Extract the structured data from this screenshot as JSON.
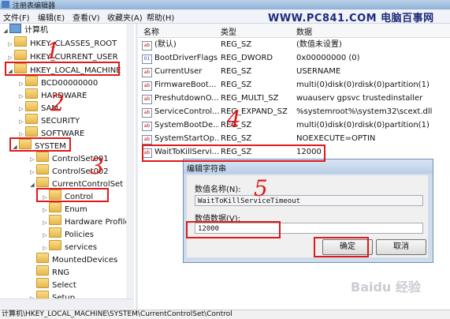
{
  "window": {
    "title": "注册表编辑器"
  },
  "menu": [
    "文件(F)",
    "编辑(E)",
    "查看(V)",
    "收藏夹(A)",
    "帮助(H)"
  ],
  "watermark": "WWW.PC841.COM 电脑百事网",
  "tree": {
    "root": "计算机",
    "items": [
      "HKEY_CLASSES_ROOT",
      "HKEY_CURRENT_USER",
      "HKEY_LOCAL_MACHINE",
      "BCD00000000",
      "HARDWARE",
      "SAM",
      "SECURITY",
      "SOFTWARE",
      "SYSTEM",
      "ControlSet001",
      "ControlSet002",
      "CurrentControlSet",
      "Control",
      "Enum",
      "Hardware Profile",
      "Policies",
      "services",
      "MountedDevices",
      "RNG",
      "Select",
      "Setup"
    ]
  },
  "columns": {
    "name": "名称",
    "type": "类型",
    "data": "数据"
  },
  "values": [
    {
      "name": "(默认)",
      "type": "REG_SZ",
      "data": "(数值未设置)",
      "icon": "string-icon"
    },
    {
      "name": "BootDriverFlags",
      "type": "REG_DWORD",
      "data": "0x00000000 (0)",
      "icon": "binary-icon"
    },
    {
      "name": "CurrentUser",
      "type": "REG_SZ",
      "data": "USERNAME",
      "icon": "string-icon"
    },
    {
      "name": "FirmwareBoot...",
      "type": "REG_SZ",
      "data": "multi(0)disk(0)rdisk(0)partition(1)",
      "icon": "string-icon"
    },
    {
      "name": "PreshutdownO...",
      "type": "REG_MULTI_SZ",
      "data": "wuauserv gpsvc trustedinstaller",
      "icon": "string-icon"
    },
    {
      "name": "ServiceControl...",
      "type": "REG_EXPAND_SZ",
      "data": "%systemroot%\\system32\\scext.dll",
      "icon": "string-icon"
    },
    {
      "name": "SystemBootDe...",
      "type": "REG_SZ",
      "data": "multi(0)disk(0)rdisk(0)partition(1)",
      "icon": "string-icon"
    },
    {
      "name": "SystemStartOp...",
      "type": "REG_SZ",
      "data": "NOEXECUTE=OPTIN",
      "icon": "string-icon"
    },
    {
      "name": "WaitToKillServi...",
      "type": "REG_SZ",
      "data": "12000",
      "icon": "string-icon"
    }
  ],
  "dialog": {
    "title": "编辑字符串",
    "name_label": "数值名称(N):",
    "name_value": "WaitToKillServiceTimeout",
    "data_label": "数值数据(V):",
    "data_value": "12000",
    "ok": "确定",
    "cancel": "取消"
  },
  "statusbar": "计算机\\HKEY_LOCAL_MACHINE\\SYSTEM\\CurrentControlSet\\Control",
  "annotations": [
    "1",
    "2",
    "3",
    "4",
    "5"
  ],
  "baidu_mark": "Baidu 经验",
  "colors": {
    "annotation": "#e01919",
    "title_blue": "#1d2b7a"
  }
}
